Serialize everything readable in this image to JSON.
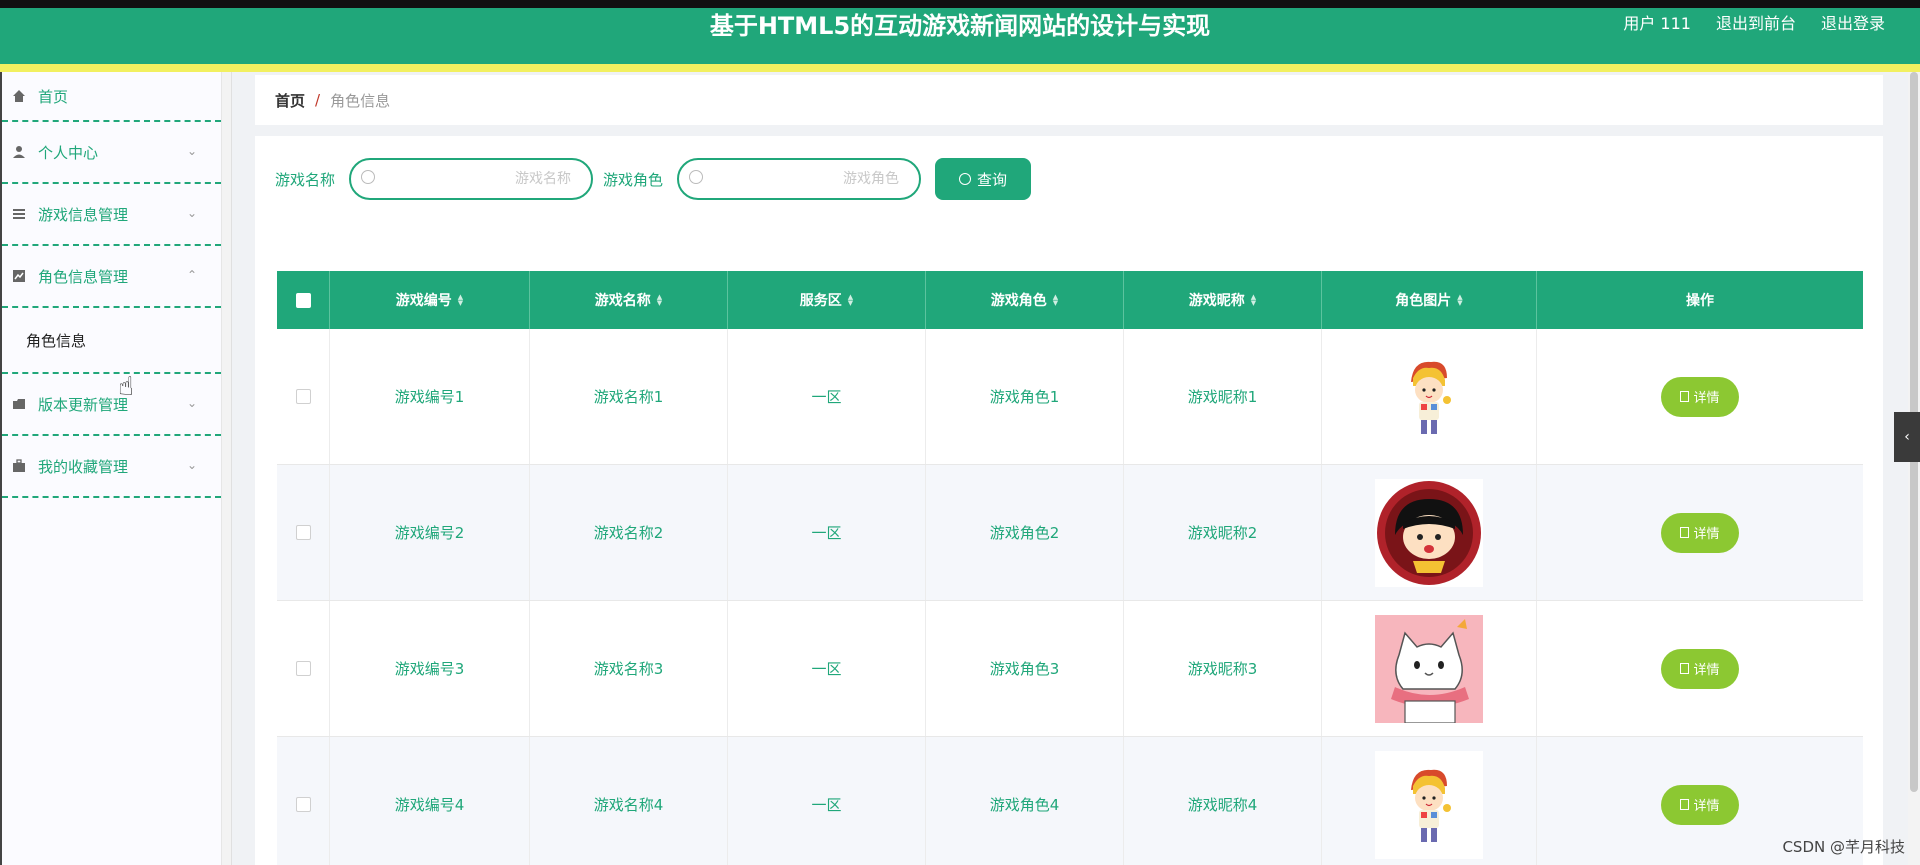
{
  "header": {
    "title": "基于HTML5的互动游戏新闻网站的设计与实现",
    "user_label": "用户 111",
    "front_label": "退出到前台",
    "logout_label": "退出登录",
    "colors": {
      "primary": "#20a77a",
      "stripe": "#f2f060",
      "detail": "#8cc832"
    }
  },
  "sidebar": {
    "items": [
      {
        "label": "首页",
        "icon": "home-icon"
      },
      {
        "label": "个人中心",
        "icon": "user-icon"
      },
      {
        "label": "游戏信息管理",
        "icon": "list-icon"
      },
      {
        "label": "角色信息管理",
        "icon": "chart-icon",
        "expanded": true,
        "sub": [
          "角色信息"
        ]
      },
      {
        "label": "版本更新管理",
        "icon": "folder-icon"
      },
      {
        "label": "我的收藏管理",
        "icon": "briefcase-icon"
      }
    ]
  },
  "breadcrumb": {
    "home": "首页",
    "separator": "/",
    "current": "角色信息"
  },
  "search": {
    "name_label": "游戏名称",
    "name_placeholder": "游戏名称",
    "role_label": "游戏角色",
    "role_placeholder": "游戏角色",
    "button_label": "查询"
  },
  "table": {
    "columns": [
      "游戏编号",
      "游戏名称",
      "服务区",
      "游戏角色",
      "游戏昵称",
      "角色图片",
      "操作"
    ],
    "rows": [
      {
        "id": "游戏编号1",
        "name": "游戏名称1",
        "server": "一区",
        "role": "游戏角色1",
        "nick": "游戏昵称1",
        "image": "boy-avatar",
        "action": "详情"
      },
      {
        "id": "游戏编号2",
        "name": "游戏名称2",
        "server": "一区",
        "role": "游戏角色2",
        "nick": "游戏昵称2",
        "image": "girl-avatar",
        "action": "详情"
      },
      {
        "id": "游戏编号3",
        "name": "游戏名称3",
        "server": "一区",
        "role": "游戏角色3",
        "nick": "游戏昵称3",
        "image": "cat-avatar",
        "action": "详情"
      },
      {
        "id": "游戏编号4",
        "name": "游戏名称4",
        "server": "一区",
        "role": "游戏角色4",
        "nick": "游戏昵称4",
        "image": "boy-avatar",
        "action": "详情"
      }
    ]
  },
  "watermark": "CSDN @芊月科技"
}
